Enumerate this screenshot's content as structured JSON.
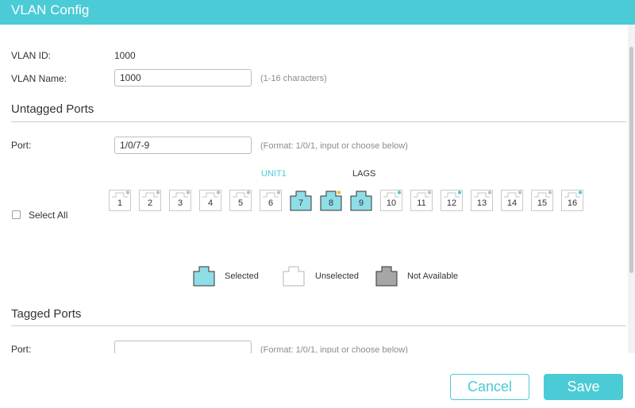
{
  "dialog": {
    "title": "VLAN Config"
  },
  "vlan": {
    "id_label": "VLAN ID:",
    "id_value": "1000",
    "name_label": "VLAN Name:",
    "name_value": "1000",
    "name_hint": "(1-16 characters)"
  },
  "untagged": {
    "section_title": "Untagged Ports",
    "port_label": "Port:",
    "port_value": "1/0/7-9",
    "port_hint": "(Format: 1/0/1, input or choose below)",
    "tabs": [
      {
        "label": "UNIT1",
        "active": true
      },
      {
        "label": "LAGS",
        "active": false
      }
    ],
    "select_all_label": "Select All",
    "ports": [
      {
        "num": "1",
        "state": "unselected",
        "led": "gray"
      },
      {
        "num": "2",
        "state": "unselected",
        "led": "gray"
      },
      {
        "num": "3",
        "state": "unselected",
        "led": "gray"
      },
      {
        "num": "4",
        "state": "unselected",
        "led": "gray"
      },
      {
        "num": "5",
        "state": "unselected",
        "led": "gray"
      },
      {
        "num": "6",
        "state": "unselected",
        "led": "gray"
      },
      {
        "num": "7",
        "state": "selected",
        "led": "none"
      },
      {
        "num": "8",
        "state": "selected",
        "led": "orange"
      },
      {
        "num": "9",
        "state": "selected",
        "led": "none"
      },
      {
        "num": "10",
        "state": "unselected",
        "led": "cyan"
      },
      {
        "num": "11",
        "state": "unselected",
        "led": "gray"
      },
      {
        "num": "12",
        "state": "unselected",
        "led": "cyan"
      },
      {
        "num": "13",
        "state": "unselected",
        "led": "gray"
      },
      {
        "num": "14",
        "state": "unselected",
        "led": "gray"
      },
      {
        "num": "15",
        "state": "unselected",
        "led": "gray"
      },
      {
        "num": "16",
        "state": "unselected",
        "led": "cyan"
      }
    ]
  },
  "legend": {
    "selected": "Selected",
    "unselected": "Unselected",
    "not_available": "Not Available"
  },
  "tagged": {
    "section_title": "Tagged Ports",
    "port_label": "Port:",
    "port_value": "",
    "port_hint": "(Format: 1/0/1, input or choose below)"
  },
  "buttons": {
    "cancel": "Cancel",
    "save": "Save"
  },
  "colors": {
    "accent": "#4acbd6",
    "selected_fill": "#8fdde6",
    "unavailable_fill": "#a6a6a6",
    "led_orange": "#f5b62a",
    "led_cyan": "#4acbd6",
    "led_gray": "#bdbdbd"
  }
}
